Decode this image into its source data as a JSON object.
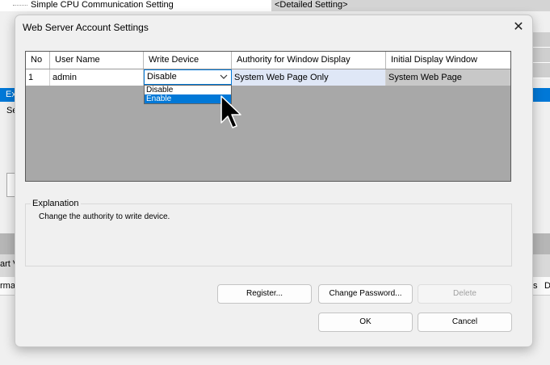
{
  "background": {
    "top_row_label": "Simple CPU Communication Setting",
    "top_row_value": "<Detailed Setting>",
    "blue_bar_text": "Ex",
    "side_text": "Se",
    "lower_row_text": "art V",
    "header_row_left": "rma",
    "header_row_right_1": "s",
    "header_row_right_2": "D"
  },
  "dialog": {
    "title": "Web Server Account Settings",
    "close_glyph": "✕",
    "table": {
      "headers": [
        "No",
        "User Name",
        "Write Device",
        "Authority for Window Display",
        "Initial Display Window"
      ],
      "row": {
        "no": "1",
        "user_name": "admin",
        "write_device": "Disable",
        "authority": "System Web Page Only",
        "initial_window": "System Web Page"
      },
      "dropdown_options": [
        "Disable",
        "Enable"
      ],
      "dropdown_selected_index": 1
    },
    "explanation": {
      "legend": "Explanation",
      "text": "Change the authority to write device."
    },
    "buttons": {
      "register": "Register...",
      "change_password": "Change Password...",
      "delete": "Delete",
      "ok": "OK",
      "cancel": "Cancel"
    }
  },
  "icons": {
    "close": "close-icon",
    "dropdown_arrow": "chevron-down-icon",
    "cursor": "mouse-pointer-icon"
  },
  "colors": {
    "accent": "#0078d7",
    "grid_background": "#a8a8a8",
    "dialog_background": "#f0f0f0"
  }
}
